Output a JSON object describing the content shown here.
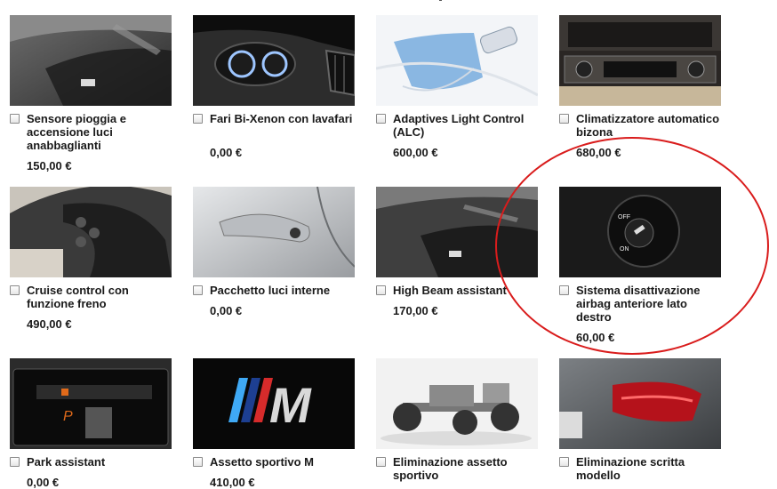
{
  "products": [
    {
      "name": "Sensore pioggia e accensione luci anabbaglianti",
      "price": "150,00 €",
      "icon": "rain-sensor-mirror"
    },
    {
      "name": "Fari Bi-Xenon con lavafari",
      "price": "0,00 €",
      "icon": "xenon-headlights"
    },
    {
      "name": "Adaptives Light Control (ALC)",
      "price": "600,00 €",
      "icon": "adaptive-light-beam"
    },
    {
      "name": "Climatizzatore automatico bizona",
      "price": "680,00 €",
      "icon": "climate-control-panel"
    },
    {
      "name": "Cruise control con funzione freno",
      "price": "490,00 €",
      "icon": "steering-wheel-buttons"
    },
    {
      "name": "Pacchetto luci interne",
      "price": "0,00 €",
      "icon": "door-handle"
    },
    {
      "name": "High Beam assistant",
      "price": "170,00 €",
      "icon": "rear-view-mirror-sensor"
    },
    {
      "name": "Sistema disattivazione airbag anteriore lato destro",
      "price": "60,00 €",
      "icon": "airbag-key-switch"
    },
    {
      "name": "Park assistant",
      "price": "0,00 €",
      "icon": "park-display"
    },
    {
      "name": "Assetto sportivo M",
      "price": "410,00 €",
      "icon": "m-logo"
    },
    {
      "name": "Eliminazione assetto sportivo",
      "price": "",
      "icon": "chassis"
    },
    {
      "name": "Eliminazione scritta modello",
      "price": "",
      "icon": "tail-light"
    }
  ],
  "airbag_switch": {
    "off_label": "OFF",
    "on_label": "ON",
    "ring_text": "PASSENGER AIR BAG"
  },
  "m_logo_letter": "M",
  "park_letter": "P",
  "highlight_color": "#d91c1c"
}
